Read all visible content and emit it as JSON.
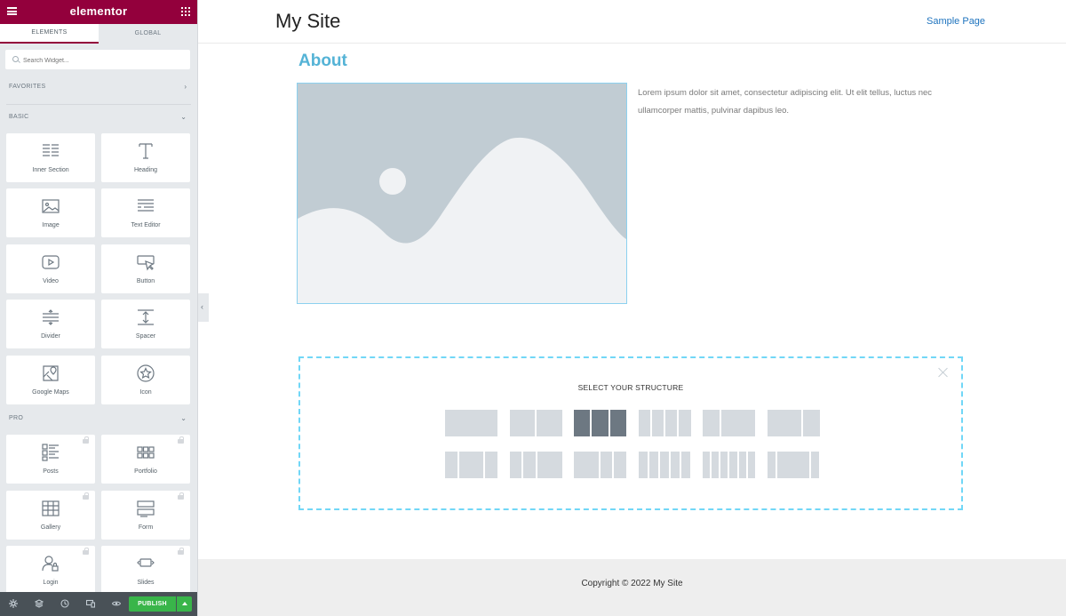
{
  "editor": {
    "brand": "elementor",
    "tabs": [
      "ELEMENTS",
      "GLOBAL"
    ],
    "search_placeholder": "Search Widget...",
    "categories": {
      "favorites": "FAVORITES",
      "basic": "BASIC",
      "pro": "PRO"
    },
    "basic_widgets": [
      {
        "label": "Inner Section",
        "icon": "inner-section-icon"
      },
      {
        "label": "Heading",
        "icon": "heading-icon"
      },
      {
        "label": "Image",
        "icon": "image-icon"
      },
      {
        "label": "Text Editor",
        "icon": "text-editor-icon"
      },
      {
        "label": "Video",
        "icon": "video-icon"
      },
      {
        "label": "Button",
        "icon": "button-icon"
      },
      {
        "label": "Divider",
        "icon": "divider-icon"
      },
      {
        "label": "Spacer",
        "icon": "spacer-icon"
      },
      {
        "label": "Google Maps",
        "icon": "google-maps-icon"
      },
      {
        "label": "Icon",
        "icon": "star-icon"
      }
    ],
    "pro_widgets": [
      {
        "label": "Posts",
        "icon": "posts-icon"
      },
      {
        "label": "Portfolio",
        "icon": "portfolio-icon"
      },
      {
        "label": "Gallery",
        "icon": "gallery-icon"
      },
      {
        "label": "Form",
        "icon": "form-icon"
      },
      {
        "label": "Login",
        "icon": "login-icon"
      },
      {
        "label": "Slides",
        "icon": "slides-icon"
      }
    ],
    "publish_label": "PUBLISH",
    "footer_tools": [
      "settings-icon",
      "navigator-icon",
      "history-icon",
      "responsive-icon",
      "preview-icon"
    ]
  },
  "site": {
    "title": "My Site",
    "nav_link": "Sample Page",
    "page_heading": "About",
    "body_text": "Lorem ipsum dolor sit amet, consectetur adipiscing elit. Ut elit tellus, luctus nec ullamcorper mattis, pulvinar dapibus leo.",
    "copyright": "Copyright © 2022 My Site"
  },
  "structure": {
    "title": "SELECT YOUR STRUCTURE",
    "selected_preset": 3,
    "presets": [
      {
        "columns": [
          1
        ]
      },
      {
        "columns": [
          1,
          1
        ]
      },
      {
        "columns": [
          1,
          1,
          1
        ]
      },
      {
        "columns": [
          1,
          1,
          1,
          1
        ]
      },
      {
        "columns": [
          1,
          2
        ]
      },
      {
        "columns": [
          2,
          1
        ]
      },
      {
        "columns": [
          1,
          2,
          1
        ]
      },
      {
        "columns": [
          1,
          1,
          2
        ]
      },
      {
        "columns": [
          2,
          1,
          1
        ]
      },
      {
        "columns": [
          1,
          1,
          1,
          1,
          1
        ]
      },
      {
        "columns": [
          1,
          1,
          1,
          1,
          1,
          1
        ]
      },
      {
        "columns": [
          1,
          4,
          1
        ]
      }
    ]
  },
  "colors": {
    "brand": "#93003c",
    "accent": "#54b3d6",
    "publish": "#39b54a",
    "link": "#1e73be"
  }
}
